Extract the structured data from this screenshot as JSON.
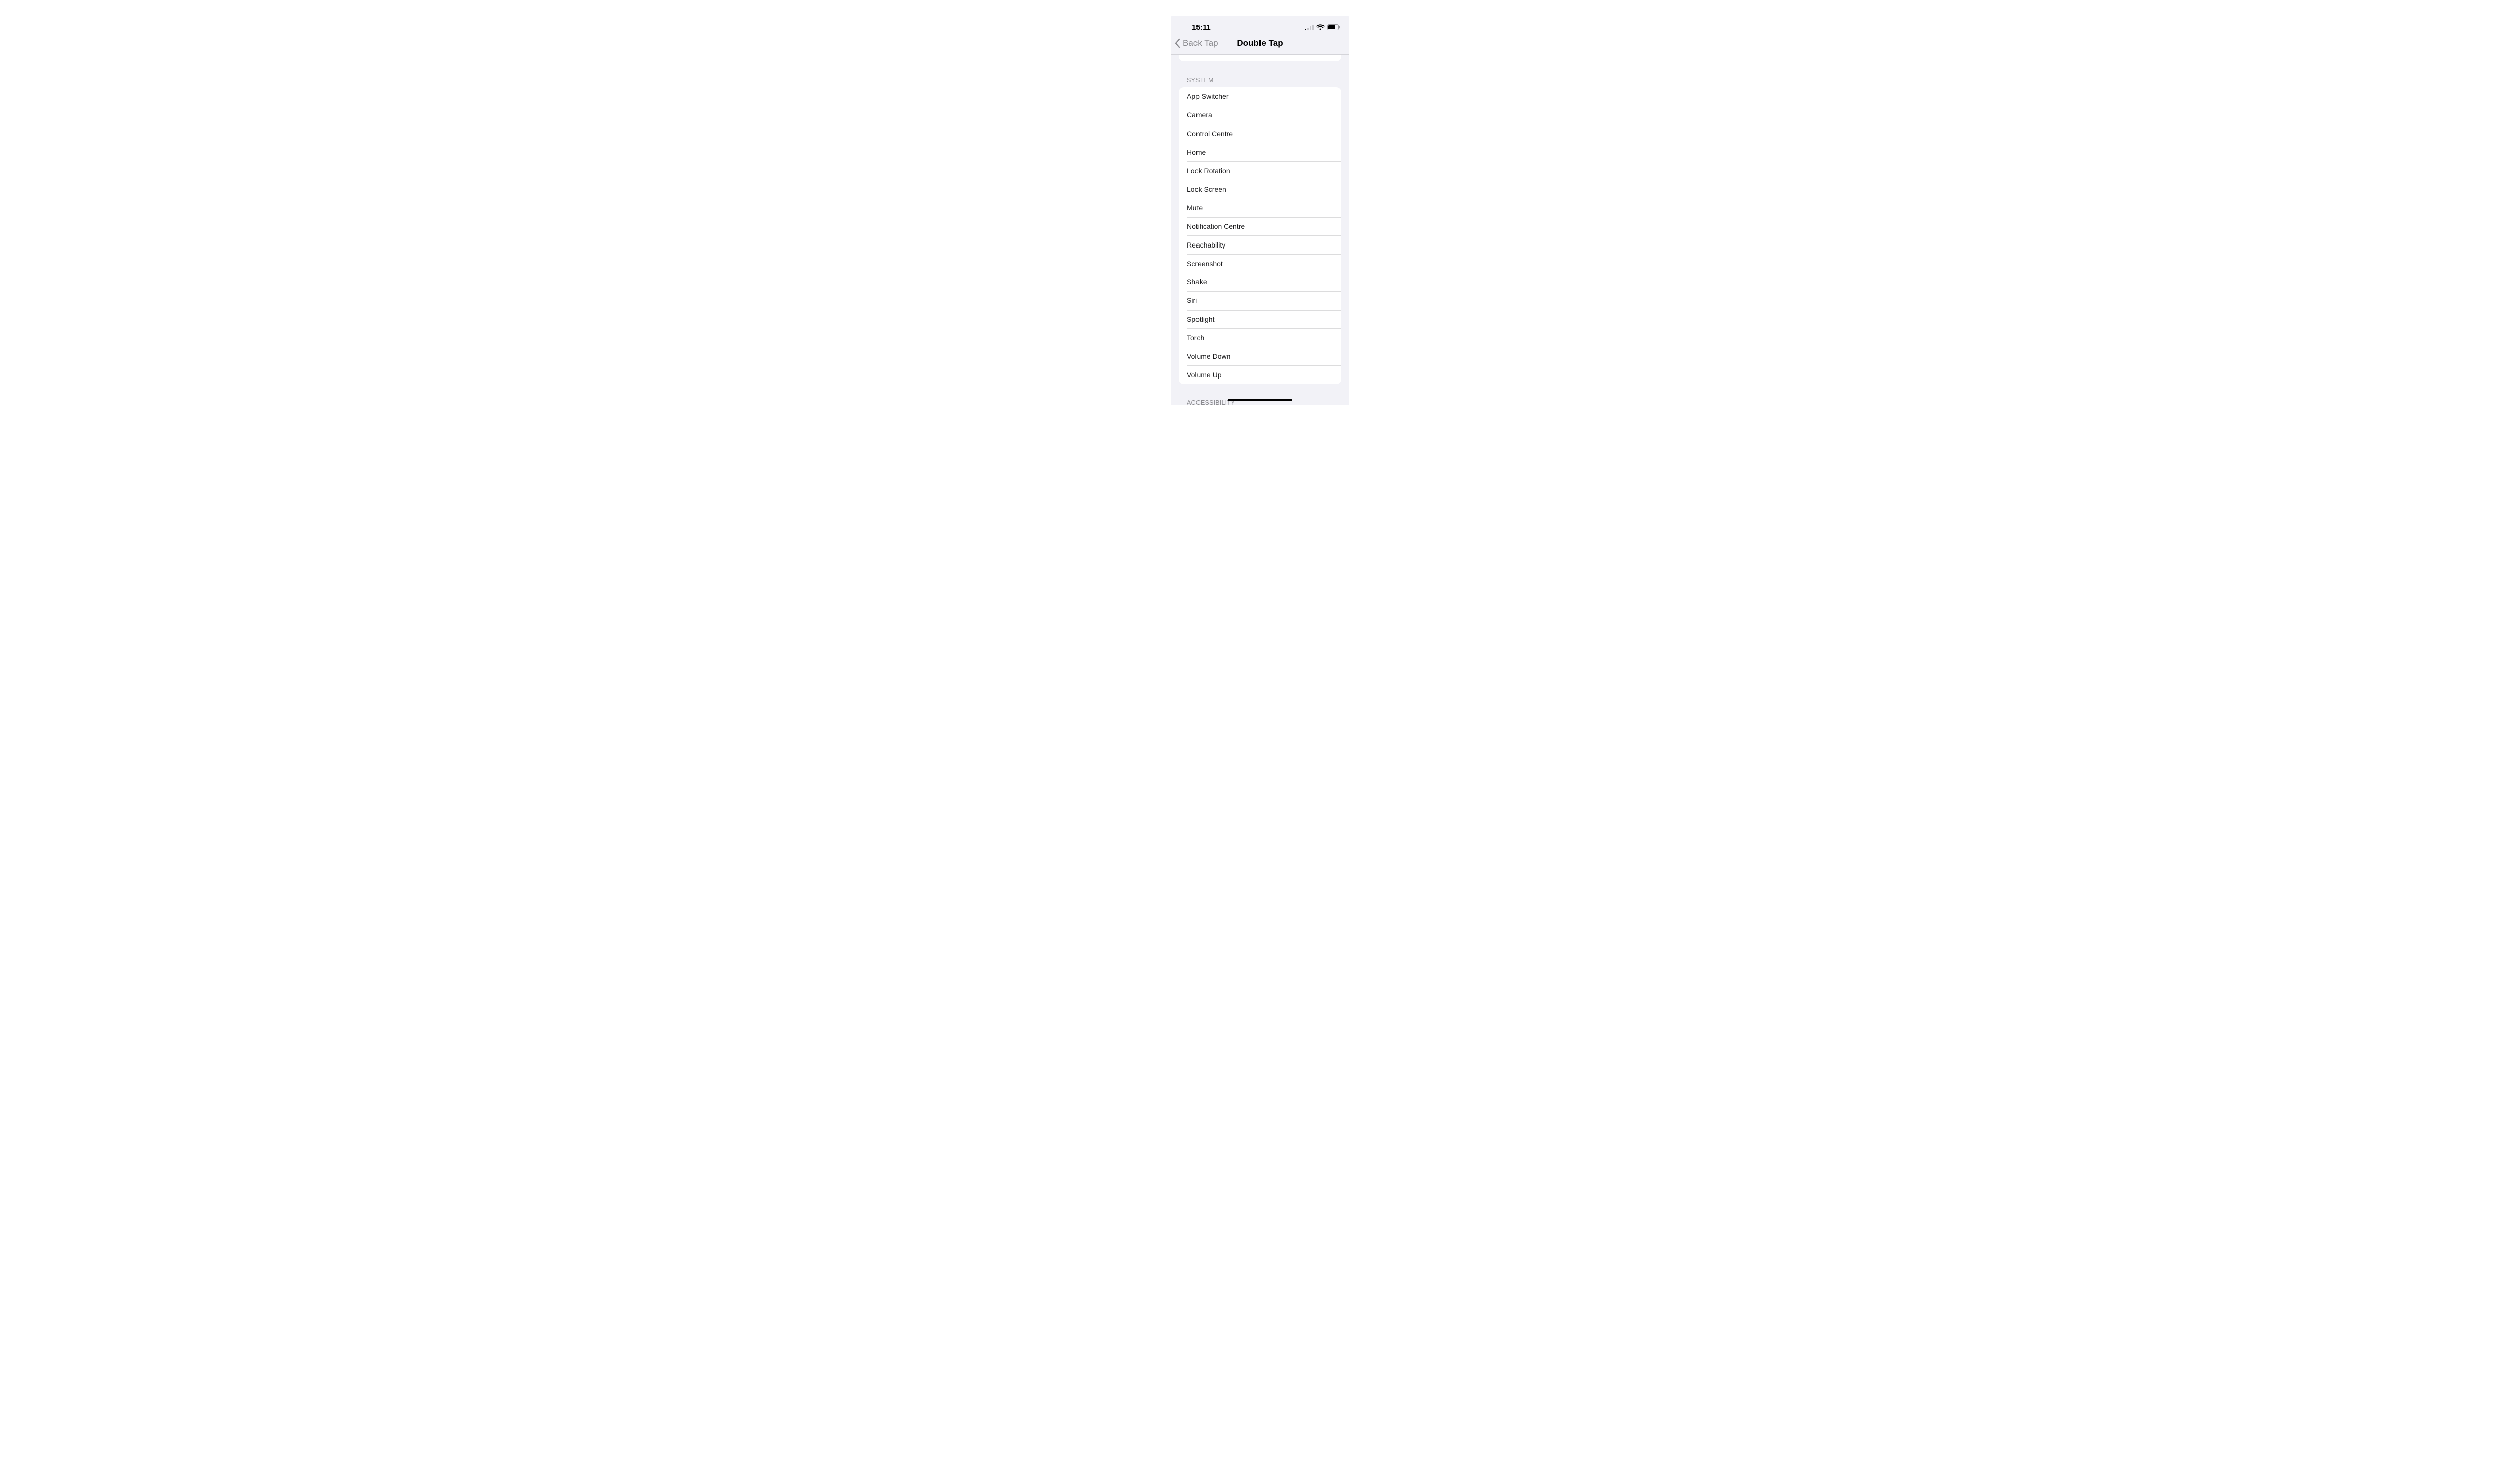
{
  "status": {
    "time": "15:11"
  },
  "nav": {
    "back_label": "Back Tap",
    "title": "Double Tap"
  },
  "sections": {
    "system": {
      "header": "SYSTEM",
      "items": [
        "App Switcher",
        "Camera",
        "Control Centre",
        "Home",
        "Lock Rotation",
        "Lock Screen",
        "Mute",
        "Notification Centre",
        "Reachability",
        "Screenshot",
        "Shake",
        "Siri",
        "Spotlight",
        "Torch",
        "Volume Down",
        "Volume Up"
      ]
    },
    "accessibility": {
      "header": "ACCESSIBILITY"
    }
  }
}
